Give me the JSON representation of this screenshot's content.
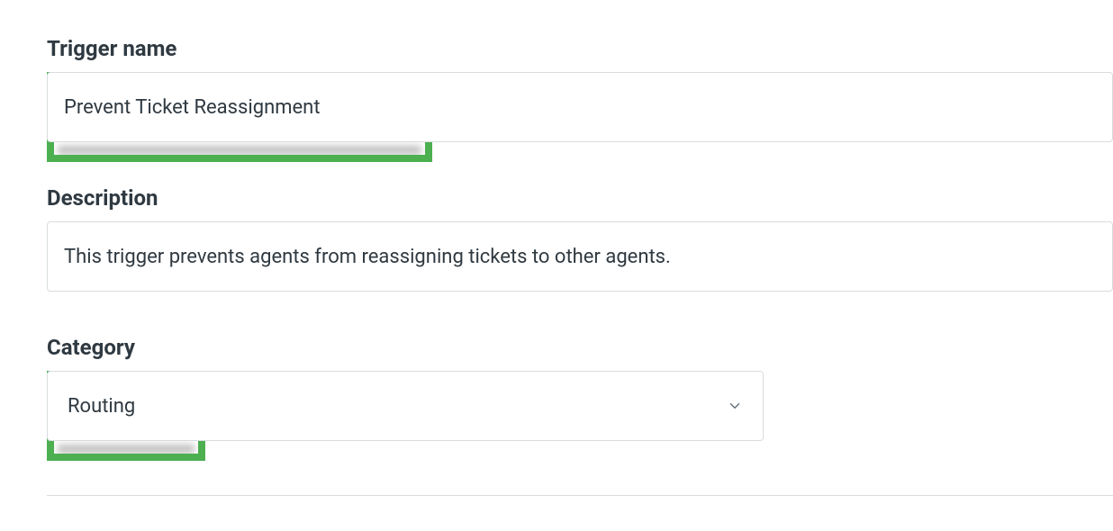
{
  "form": {
    "trigger_name": {
      "label": "Trigger name",
      "value": "Prevent Ticket Reassignment"
    },
    "description": {
      "label": "Description",
      "value": "This trigger prevents agents from reassigning tickets to other agents."
    },
    "category": {
      "label": "Category",
      "selected": "Routing"
    }
  },
  "colors": {
    "highlight": "#4caf50",
    "border": "#d8dcde",
    "text": "#2f3941"
  }
}
